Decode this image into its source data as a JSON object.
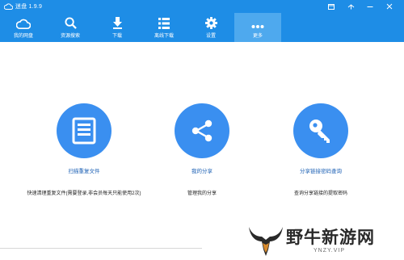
{
  "window": {
    "title": "迷盘 1.9.9"
  },
  "toolbar": {
    "items": [
      {
        "label": "我的网盘",
        "icon": "cloud-icon"
      },
      {
        "label": "资源搜索",
        "icon": "search-icon"
      },
      {
        "label": "下载",
        "icon": "download-icon"
      },
      {
        "label": "离线下载",
        "icon": "list-icon"
      },
      {
        "label": "设置",
        "icon": "gear-icon"
      },
      {
        "label": "更多",
        "icon": "more-icon",
        "active": true
      }
    ]
  },
  "features": [
    {
      "title": "扫描重复文件",
      "desc": "快速清理重复文件(需要登录,非会员每天只能使用2次)",
      "icon": "document-list-icon"
    },
    {
      "title": "我的分享",
      "desc": "管理我的分享",
      "icon": "share-icon"
    },
    {
      "title": "分享链接密码查询",
      "desc": "查询分享链接的提取密码",
      "icon": "key-icon"
    }
  ],
  "watermark": {
    "title": "野牛新游网",
    "url": "YNZY.VIP"
  },
  "colors": {
    "toolbar_bg": "#1e8de6",
    "toolbar_active": "#4ea9ee",
    "circle_bg": "#3a8ff0",
    "link_text": "#1a5fb4"
  }
}
